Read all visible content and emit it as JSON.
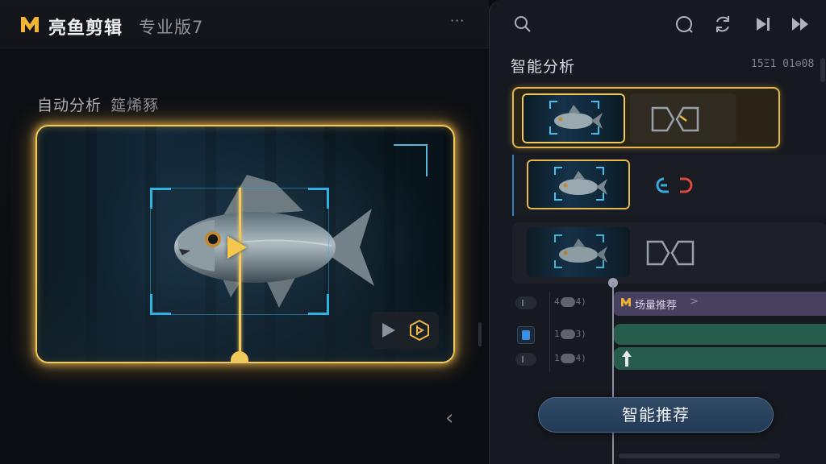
{
  "app": {
    "name": "亮鱼剪辑",
    "edition": "专业版7",
    "more": "···"
  },
  "left_panel": {
    "title": "自动分析",
    "subtitle": "筵烯豩"
  },
  "right_panel": {
    "title": "智能分析",
    "timecode": "15Ξ1 01⊜08",
    "tools": [
      "search-icon",
      "record-icon",
      "refresh-icon",
      "step-forward-icon",
      "fast-forward-icon"
    ],
    "tracks": [
      {
        "label_a": "4",
        "label_b": "4)"
      },
      {
        "label_a": "1",
        "label_b": "3)"
      },
      {
        "label_a": "1",
        "label_b": "4)"
      }
    ],
    "scene_clip": {
      "label": "场量推荐",
      "chevron": ">"
    },
    "smart_button": "智能推荐"
  },
  "colors": {
    "accent_gold": "#f2c95b",
    "box_blue": "#2fb1e2",
    "button_blue": "#2c4662",
    "clip_purple": "#47405f",
    "clip_green": "#275c4c"
  }
}
